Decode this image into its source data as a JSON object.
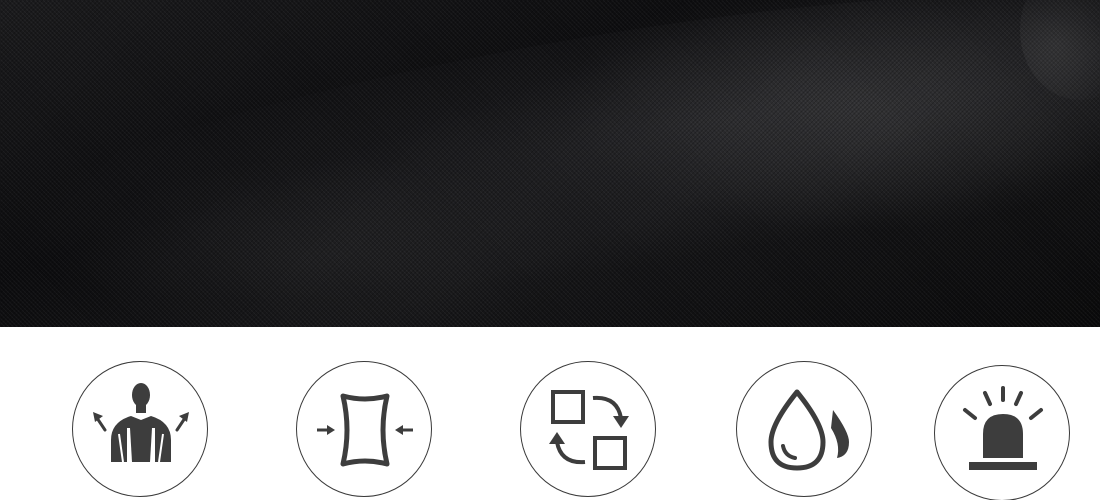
{
  "colors": {
    "fabric": "#111113",
    "icon": "#3d3d3d",
    "circle_border": "#3a3a3a",
    "background": "#ffffff"
  },
  "features": [
    {
      "icon": "shoulder-relief-icon"
    },
    {
      "icon": "compression-padding-icon"
    },
    {
      "icon": "swap-convertible-icon"
    },
    {
      "icon": "water-resistant-icon"
    },
    {
      "icon": "alarm-beacon-icon"
    }
  ]
}
